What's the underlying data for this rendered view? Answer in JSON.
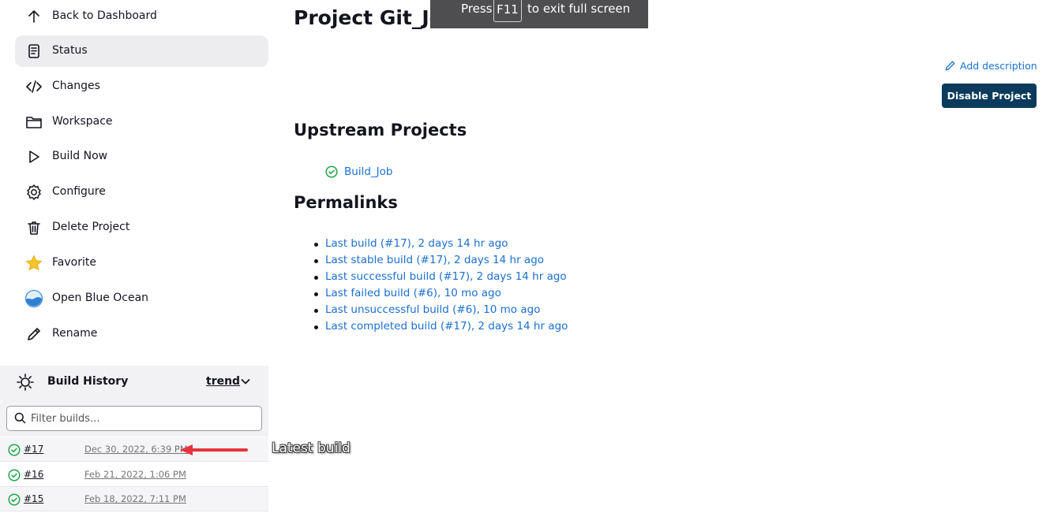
{
  "fullscreen_hint": {
    "press": "Press",
    "key": "F11",
    "rest": "to exit full screen"
  },
  "sidebar": {
    "items": [
      {
        "label": "Back to Dashboard",
        "icon": "arrow-up-icon"
      },
      {
        "label": "Status",
        "icon": "document-icon",
        "active": true
      },
      {
        "label": "Changes",
        "icon": "code-icon"
      },
      {
        "label": "Workspace",
        "icon": "folder-icon"
      },
      {
        "label": "Build Now",
        "icon": "play-icon"
      },
      {
        "label": "Configure",
        "icon": "gear-icon"
      },
      {
        "label": "Delete Project",
        "icon": "trash-icon"
      },
      {
        "label": "Favorite",
        "icon": "star-icon"
      },
      {
        "label": "Open Blue Ocean",
        "icon": "blue-ocean-icon"
      },
      {
        "label": "Rename",
        "icon": "pencil-icon"
      }
    ]
  },
  "build_history": {
    "title": "Build History",
    "trend_label": "trend",
    "filter_placeholder": "Filter builds...",
    "builds": [
      {
        "number": "#17",
        "date": "Dec 30, 2022, 6:39 PM",
        "status": "success"
      },
      {
        "number": "#16",
        "date": "Feb 21, 2022, 1:06 PM",
        "status": "success"
      },
      {
        "number": "#15",
        "date": "Feb 18, 2022, 7:11 PM",
        "status": "success"
      }
    ]
  },
  "annotation": {
    "text": "Latest build",
    "color": "#e8323c"
  },
  "main": {
    "title": "Project Git_Job",
    "add_description": "Add description",
    "disable_button": "Disable Project",
    "upstream_heading": "Upstream Projects",
    "upstream_projects": [
      {
        "name": "Build_Job",
        "status": "success"
      }
    ],
    "permalinks_heading": "Permalinks",
    "permalinks": [
      "Last build (#17), 2 days 14 hr ago",
      "Last stable build (#17), 2 days 14 hr ago",
      "Last successful build (#17), 2 days 14 hr ago",
      "Last failed build (#6), 10 mo ago",
      "Last unsuccessful build (#6), 10 mo ago",
      "Last completed build (#17), 2 days 14 hr ago"
    ]
  },
  "colors": {
    "link": "#1a6fd1",
    "success": "#1ea64b",
    "primary_button": "#0b3b5c",
    "active_item_bg": "#ededf0"
  }
}
